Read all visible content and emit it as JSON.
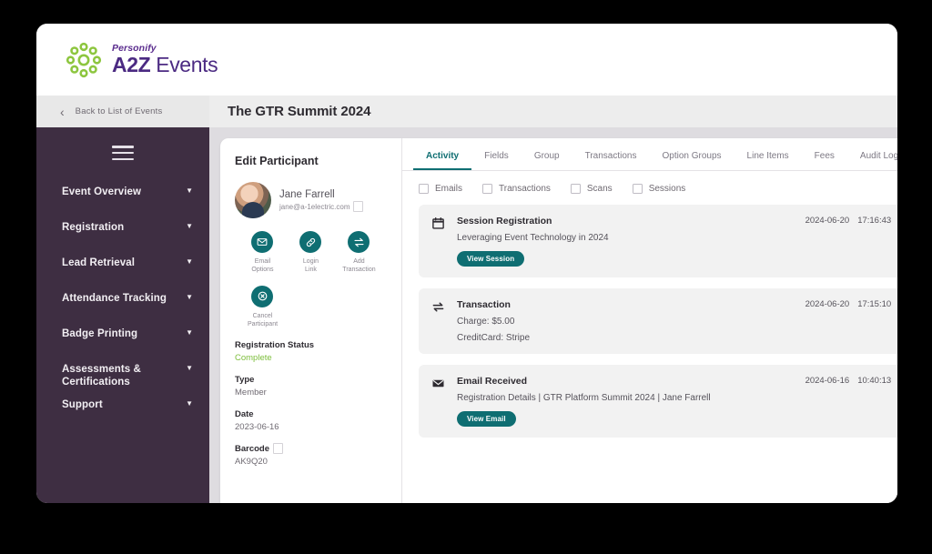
{
  "brand": {
    "personify": "Personify",
    "product_bold": "A2Z",
    "product_light": " Events",
    "logo_icon": "flower-mark-icon"
  },
  "backbar": {
    "label": "Back to List of Events",
    "chevron": "‹"
  },
  "sidebar": {
    "menu_icon": "hamburger-icon",
    "items": [
      {
        "label": "Event Overview",
        "caret": "▼"
      },
      {
        "label": "Registration",
        "caret": "▼"
      },
      {
        "label": "Lead Retrieval",
        "caret": "▼"
      },
      {
        "label": "Attendance Tracking",
        "caret": "▼"
      },
      {
        "label": "Badge Printing",
        "caret": "▼"
      },
      {
        "label": "Assessments & Certifications",
        "caret": "▼"
      },
      {
        "label": "Support",
        "caret": "▼"
      }
    ]
  },
  "page": {
    "title": "The GTR Summit 2024"
  },
  "participant": {
    "panel_title": "Edit Participant",
    "avatar_icon": "user-avatar",
    "name": "Jane Farrell",
    "email": "jane@a-1electric.com",
    "copy_email_icon": "copy-icon",
    "actions": [
      {
        "label": "Email\nOptions",
        "label_l1": "Email",
        "label_l2": "Options",
        "icon": "envelope-icon"
      },
      {
        "label": "Login\nLink",
        "label_l1": "Login",
        "label_l2": "Link",
        "icon": "link-icon"
      },
      {
        "label": "Add\nTransaction",
        "label_l1": "Add",
        "label_l2": "Transaction",
        "icon": "transaction-arrows-icon"
      },
      {
        "label": "Cancel\nParticipant",
        "label_l1": "Cancel",
        "label_l2": "Participant",
        "icon": "cancel-x-icon"
      }
    ],
    "fields": [
      {
        "label": "Registration Status",
        "value": "Complete",
        "state": "ok"
      },
      {
        "label": "Type",
        "value": "Member",
        "state": ""
      },
      {
        "label": "Date",
        "value": "2023-06-16",
        "state": ""
      },
      {
        "label": "Barcode",
        "value": "AK9Q20",
        "state": "",
        "copy_icon": "copy-icon"
      }
    ]
  },
  "activity": {
    "tabs": [
      {
        "label": "Activity",
        "active": true
      },
      {
        "label": "Fields",
        "active": false
      },
      {
        "label": "Group",
        "active": false
      },
      {
        "label": "Transactions",
        "active": false
      },
      {
        "label": "Option Groups",
        "active": false
      },
      {
        "label": "Line Items",
        "active": false
      },
      {
        "label": "Fees",
        "active": false
      },
      {
        "label": "Audit Log",
        "active": false
      }
    ],
    "filters": [
      {
        "label": "Emails",
        "checked": false
      },
      {
        "label": "Transactions",
        "checked": false
      },
      {
        "label": "Scans",
        "checked": false
      },
      {
        "label": "Sessions",
        "checked": false
      }
    ],
    "cards": [
      {
        "icon": "calendar-icon",
        "title": "Session Registration",
        "date": "2024-06-20",
        "time": "17:16:43",
        "line1": "Leveraging Event Technology in 2024",
        "line2": "",
        "button": "View Session"
      },
      {
        "icon": "transaction-arrows-icon",
        "title": "Transaction",
        "date": "2024-06-20",
        "time": "17:15:10",
        "line1": "Charge: $5.00",
        "line2": "CreditCard: Stripe",
        "button": ""
      },
      {
        "icon": "envelope-icon",
        "title": "Email Received",
        "date": "2024-06-16",
        "time": "10:40:13",
        "line1": "Registration Details  |  GTR Platform Summit 2024  |  Jane Farrell",
        "line2": "",
        "button": "View Email"
      }
    ]
  },
  "colors": {
    "sidebar_purple": "#3E2E42",
    "brand_purple": "#4B2A82",
    "brand_green": "#8DC63F",
    "accent_teal": "#0F6E72",
    "status_green": "#7DBE3C",
    "card_grey": "#F2F2F2"
  }
}
